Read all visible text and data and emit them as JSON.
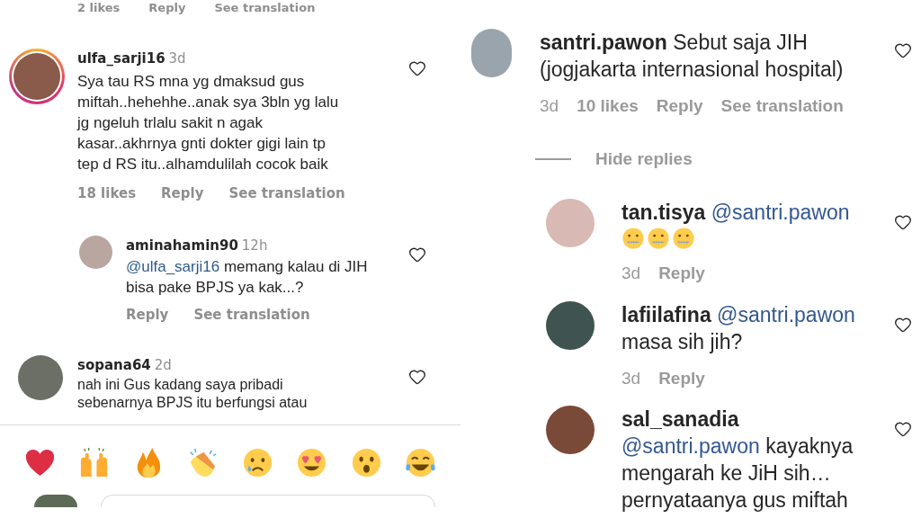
{
  "left_panel": {
    "top_actions": [
      "2 likes",
      "Reply",
      "See translation"
    ],
    "comments": [
      {
        "username": "ulfa_sarji16",
        "time": "3d",
        "story_ring": true,
        "text": "Sya tau RS mna yg dmaksud gus miftah..hehehhe..anak sya 3bln yg lalu jg ngeluh trlalu sakit n agak kasar..akhrnya gnti dokter gigi lain tp tep d RS itu..alhamdulilah cocok baik",
        "actions": [
          "18 likes",
          "Reply",
          "See translation"
        ],
        "replies": [
          {
            "username": "aminahamin90",
            "time": "12h",
            "mention": "@ulfa_sarji16",
            "text": "memang kalau di JIH bisa pake BPJS ya kak...?",
            "actions": [
              "Reply",
              "See translation"
            ]
          }
        ]
      },
      {
        "username": "sopana64",
        "time": "2d",
        "story_ring": false,
        "text": "nah ini Gus kadang saya pribadi sebenarnya BPJS itu berfungsi atau"
      }
    ],
    "reactions": [
      {
        "kind": "red-heart"
      },
      {
        "kind": "raised-hands"
      },
      {
        "kind": "fire"
      },
      {
        "kind": "clapping"
      },
      {
        "kind": "crying"
      },
      {
        "kind": "heart-eyes"
      },
      {
        "kind": "surprised"
      },
      {
        "kind": "tears-of-joy"
      }
    ]
  },
  "right_panel": {
    "comment": {
      "username": "santri.pawon",
      "text": "Sebut saja JIH (jogjakarta internasional hospital)",
      "time": "3d",
      "actions": [
        "10 likes",
        "Reply",
        "See translation"
      ]
    },
    "hide_replies": "Hide replies",
    "replies": [
      {
        "username": "tan.tisya",
        "mention": "@santri.pawon",
        "emojis": [
          {
            "kind": "zipper-mouth"
          },
          {
            "kind": "zipper-mouth"
          },
          {
            "kind": "zipper-mouth"
          }
        ],
        "time": "3d",
        "actions": [
          "Reply"
        ]
      },
      {
        "username": "lafiilafina",
        "mention": "@santri.pawon",
        "text": "masa sih jih?",
        "time": "3d",
        "actions": [
          "Reply"
        ]
      },
      {
        "username": "sal_sanadia",
        "mention": "@santri.pawon",
        "text": "kayaknya mengarah ke JiH sih… pernyataanya gus miftah"
      }
    ]
  }
}
